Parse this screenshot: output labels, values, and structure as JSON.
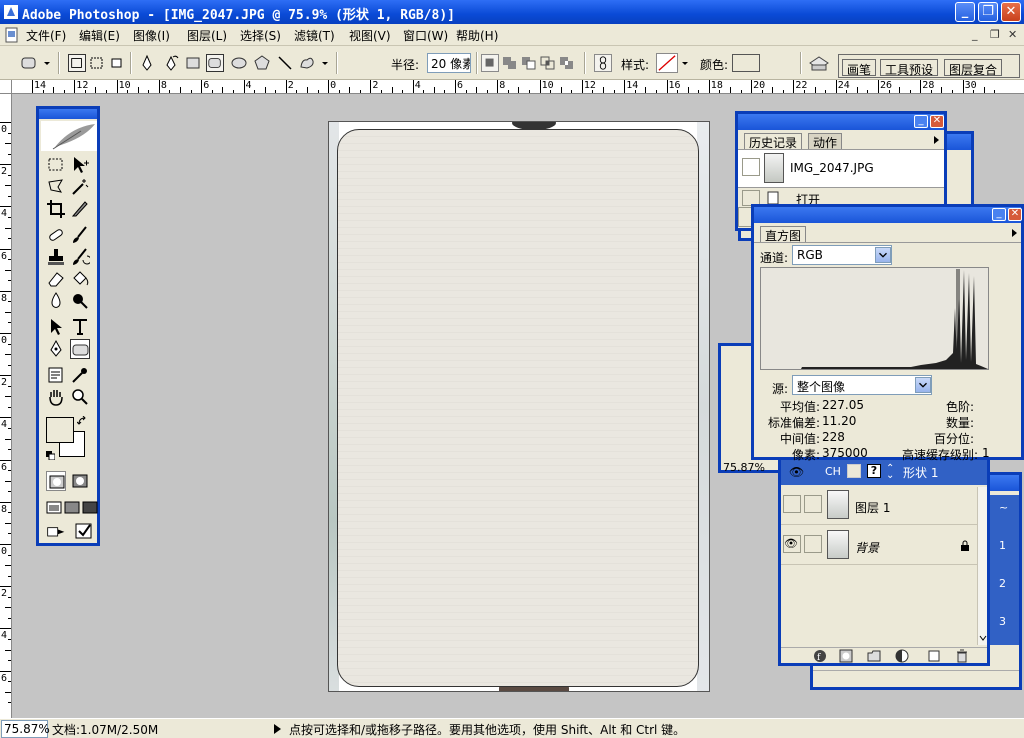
{
  "window": {
    "title": "Adobe Photoshop - [IMG_2047.JPG @ 75.9% (形状 1, RGB/8)]",
    "min_glyph": "_",
    "restore_glyph": "❐",
    "close_glyph": "✕"
  },
  "menubar": {
    "items": [
      "文件(F)",
      "编辑(E)",
      "图像(I)",
      "图层(L)",
      "选择(S)",
      "滤镜(T)",
      "视图(V)",
      "窗口(W)",
      "帮助(H)"
    ],
    "mdi_min": "_",
    "mdi_restore": "❐",
    "mdi_close": "✕"
  },
  "options": {
    "radius_label": "半径:",
    "radius_value": "20 像素",
    "style_label": "样式:",
    "color_label": "颜色:",
    "palette_tabs": [
      "画笔",
      "工具预设",
      "图层复合"
    ]
  },
  "ruler": {
    "top_labels": [
      "14",
      "12",
      "10",
      "8",
      "6",
      "4",
      "2",
      "0",
      "2",
      "4",
      "6",
      "8",
      "10",
      "12",
      "14",
      "16",
      "18",
      "20",
      "22",
      "24",
      "26",
      "28",
      "30"
    ],
    "left_labels": [
      "0",
      "2",
      "4",
      "6",
      "8",
      "0",
      "2",
      "4",
      "6",
      "8",
      "0",
      "2",
      "4",
      "6"
    ]
  },
  "history_panel": {
    "tabs": [
      "历史记录",
      "动作"
    ],
    "snapshot_name": "IMG_2047.JPG",
    "step": "打开"
  },
  "histogram_panel": {
    "tab": "直方图",
    "channel_label": "通道:",
    "channel_value": "RGB",
    "source_label": "源:",
    "source_value": "整个图像",
    "stats_left": [
      {
        "label": "平均值:",
        "value": "227.05"
      },
      {
        "label": "标准偏差:",
        "value": "11.20"
      },
      {
        "label": "中间值:",
        "value": "228"
      },
      {
        "label": "像素:",
        "value": "375000"
      }
    ],
    "stats_right": [
      {
        "label": "色阶:",
        "value": ""
      },
      {
        "label": "数量:",
        "value": ""
      },
      {
        "label": "百分位:",
        "value": ""
      },
      {
        "label": "高速缓存级别:",
        "value": "1"
      }
    ]
  },
  "navigator_panel": {
    "zoom": "75.87%"
  },
  "layers_panel": {
    "header_text": "CH",
    "layers": [
      {
        "name": "形状 1",
        "active": true,
        "visible": true
      },
      {
        "name": "图层 1",
        "active": false,
        "visible": false
      },
      {
        "name": "背景",
        "active": false,
        "visible": true,
        "locked": true
      }
    ]
  },
  "channels_side": {
    "labels": [
      "~",
      "1",
      "2",
      "3"
    ]
  },
  "statusbar": {
    "zoom": "75.87%",
    "doc_info": "文档:1.07M/2.50M",
    "hint": "点按可选择和/或拖移子路径。要用其他选项，使用 Shift、Alt 和 Ctrl 键。"
  },
  "colors": {
    "title_blue": "#0a4ad6",
    "panel_bg": "#ece9d8",
    "canvas_bg": "#c5c5c5",
    "active_layer": "#3161c5"
  }
}
